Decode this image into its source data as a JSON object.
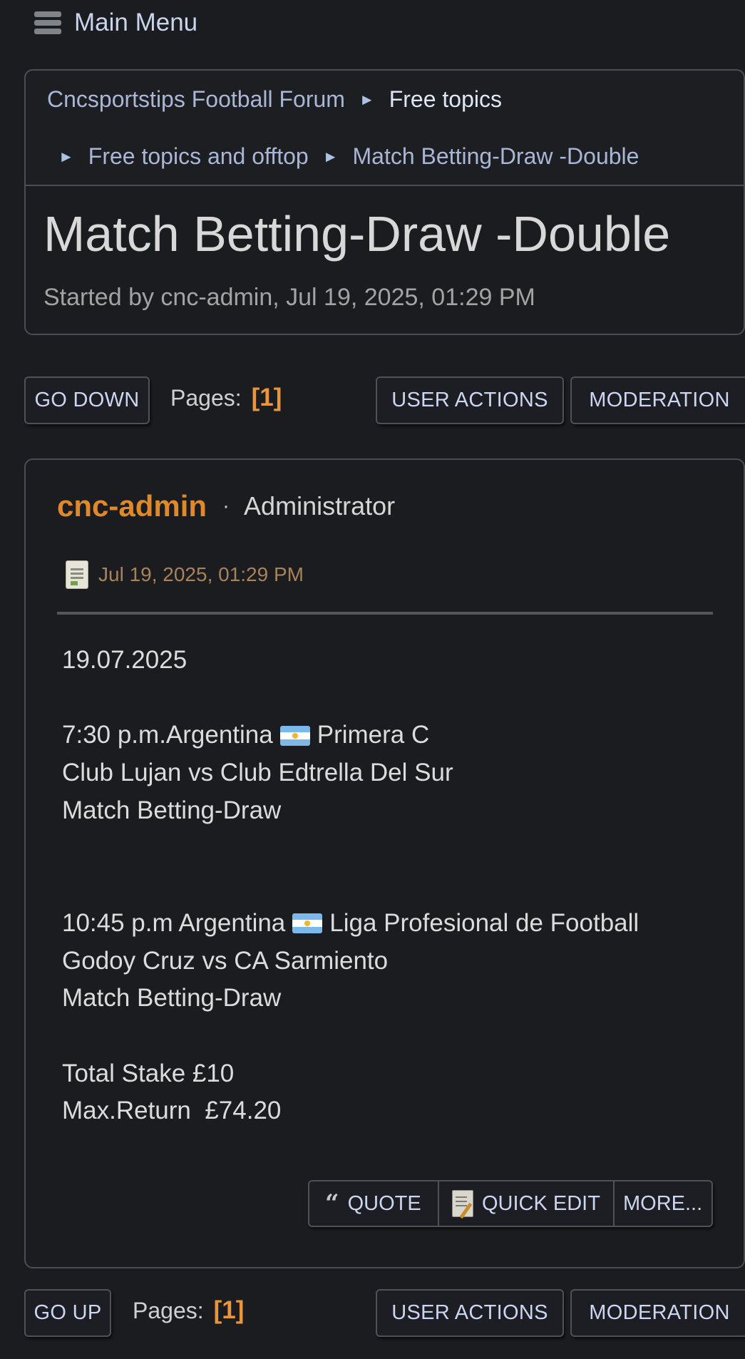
{
  "nav": {
    "main_menu": "Main Menu"
  },
  "breadcrumb": {
    "items": [
      "Cncsportstips Football Forum",
      "Free topics",
      "Free topics and offtop",
      "Match Betting-Draw -Double"
    ],
    "separator": "►"
  },
  "topic": {
    "title": "Match Betting-Draw -Double",
    "started_by": "Started by cnc-admin, Jul 19, 2025, 01:29 PM"
  },
  "pagination_top": {
    "go_label": "GO DOWN",
    "pages_label": "Pages:",
    "current_page": "[1]"
  },
  "pagination_bottom": {
    "go_label": "GO UP",
    "pages_label": "Pages:",
    "current_page": "[1]"
  },
  "buttons": {
    "user_actions": "USER ACTIONS",
    "moderation": "MODERATION"
  },
  "post": {
    "author": "cnc-admin",
    "separator": "·",
    "role": "Administrator",
    "date": "Jul 19, 2025, 01:29 PM",
    "body": {
      "date_line": "19.07.2025",
      "match1_time": "7:30 p.m.Argentina",
      "match1_league": "Primera C",
      "match1_teams": "Club Lujan vs Club Edtrella Del Sur",
      "match1_market": "Match Betting-Draw",
      "match2_time": "10:45 p.m Argentina",
      "match2_league": "Liga Profesional de Football",
      "match2_teams": "Godoy Cruz vs CA Sarmiento",
      "match2_market": "Match Betting-Draw",
      "stake": "Total Stake £10",
      "max_return": "Max.Return  £74.20"
    },
    "actions": {
      "quote": "QUOTE",
      "quick_edit": "QUICK EDIT",
      "more": "MORE..."
    }
  },
  "colors": {
    "background": "#1b1c1f",
    "accent": "#e0892b",
    "link": "#a9b6d6",
    "border": "#4b4d52"
  },
  "icons": {
    "menu": "hamburger-icon",
    "post": "document-icon",
    "quote": "quote-icon",
    "edit": "edit-icon",
    "flag": "argentina-flag-icon"
  }
}
